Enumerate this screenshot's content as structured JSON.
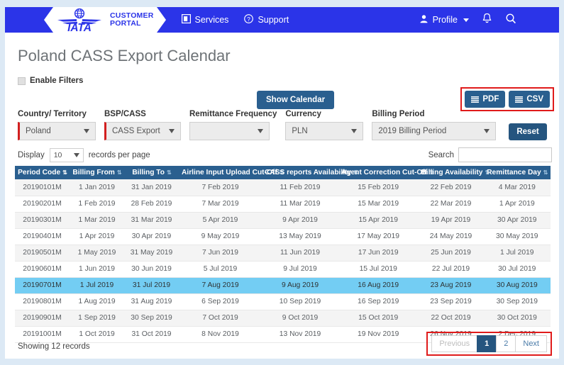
{
  "header": {
    "brand_line1": "CUSTOMER",
    "brand_line2": "PORTAL",
    "logo_text": "IATA",
    "nav": [
      {
        "label": "Services",
        "icon": "services-icon"
      },
      {
        "label": "Support",
        "icon": "question-circle-icon"
      }
    ],
    "profile_label": "Profile",
    "icons": [
      "user-icon",
      "chevron-down-icon",
      "bell-icon",
      "search-icon"
    ],
    "bg_color": "#2B34E8"
  },
  "page": {
    "title": "Poland CASS Export Calendar",
    "enable_filters_label": "Enable Filters"
  },
  "toolbar": {
    "show_calendar_label": "Show Calendar",
    "pdf_label": "PDF",
    "csv_label": "CSV",
    "reset_label": "Reset",
    "accent_color": "#2a5f8f",
    "highlight_border": "#e01b1b"
  },
  "filters": [
    {
      "label": "Country/ Territory",
      "value": "Poland",
      "required": true
    },
    {
      "label": "BSP/CASS",
      "value": "CASS Export",
      "required": true
    },
    {
      "label": "Remittance Frequency",
      "value": "",
      "required": false
    },
    {
      "label": "Currency",
      "value": "PLN",
      "required": false
    },
    {
      "label": "Billing Period",
      "value": "2019 Billing Period",
      "required": false
    }
  ],
  "display": {
    "prefix_label": "Display",
    "records_value": "10",
    "suffix_label": "records per page",
    "search_label": "Search",
    "search_value": "",
    "search_placeholder": ""
  },
  "table": {
    "columns": [
      "Period Code",
      "Billing From",
      "Billing To",
      "Airline Input Upload Cut-Off",
      "CASS reports Availability",
      "Agent Correction Cut-Off",
      "Billing Availability",
      "Remittance Day"
    ],
    "sorted_column_index": 0,
    "selected_row_index": 6,
    "rows": [
      [
        "20190101M",
        "1 Jan 2019",
        "31 Jan 2019",
        "7 Feb 2019",
        "11 Feb 2019",
        "15 Feb 2019",
        "22 Feb 2019",
        "4 Mar 2019"
      ],
      [
        "20190201M",
        "1 Feb 2019",
        "28 Feb 2019",
        "7 Mar 2019",
        "11 Mar 2019",
        "15 Mar 2019",
        "22 Mar 2019",
        "1 Apr 2019"
      ],
      [
        "20190301M",
        "1 Mar 2019",
        "31 Mar 2019",
        "5 Apr 2019",
        "9 Apr 2019",
        "15 Apr 2019",
        "19 Apr 2019",
        "30 Apr 2019"
      ],
      [
        "20190401M",
        "1 Apr 2019",
        "30 Apr 2019",
        "9 May 2019",
        "13 May 2019",
        "17 May 2019",
        "24 May 2019",
        "30 May 2019"
      ],
      [
        "20190501M",
        "1 May 2019",
        "31 May 2019",
        "7 Jun 2019",
        "11 Jun 2019",
        "17 Jun 2019",
        "25 Jun 2019",
        "1 Jul 2019"
      ],
      [
        "20190601M",
        "1 Jun 2019",
        "30 Jun 2019",
        "5 Jul 2019",
        "9 Jul 2019",
        "15 Jul 2019",
        "22 Jul 2019",
        "30 Jul 2019"
      ],
      [
        "20190701M",
        "1 Jul 2019",
        "31 Jul 2019",
        "7 Aug 2019",
        "9 Aug 2019",
        "16 Aug 2019",
        "23 Aug 2019",
        "30 Aug 2019"
      ],
      [
        "20190801M",
        "1 Aug 2019",
        "31 Aug 2019",
        "6 Sep 2019",
        "10 Sep 2019",
        "16 Sep 2019",
        "23 Sep 2019",
        "30 Sep 2019"
      ],
      [
        "20190901M",
        "1 Sep 2019",
        "30 Sep 2019",
        "7 Oct 2019",
        "9 Oct 2019",
        "15 Oct 2019",
        "22 Oct 2019",
        "30 Oct 2019"
      ],
      [
        "20191001M",
        "1 Oct 2019",
        "31 Oct 2019",
        "8 Nov 2019",
        "13 Nov 2019",
        "19 Nov 2019",
        "26 Nov 2019",
        "2 Dec 2019"
      ]
    ]
  },
  "footer": {
    "showing": "Showing 12 records",
    "pages": [
      {
        "label": "Previous",
        "state": "disabled"
      },
      {
        "label": "1",
        "state": "active"
      },
      {
        "label": "2",
        "state": "normal"
      },
      {
        "label": "Next",
        "state": "normal"
      }
    ]
  }
}
